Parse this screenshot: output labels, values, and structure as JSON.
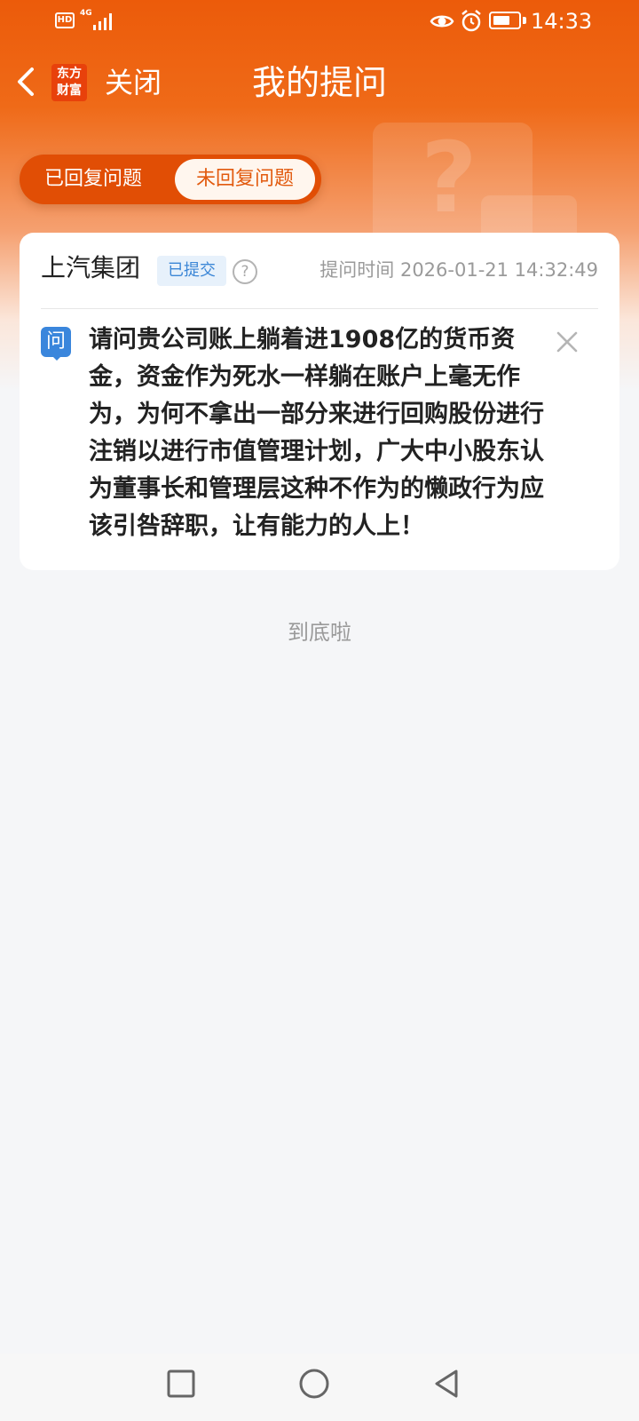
{
  "status_bar": {
    "hd": "HD",
    "network": "4G",
    "time": "14:33",
    "battery_level": 0.7
  },
  "nav": {
    "logo_text": "东方财富",
    "close_label": "关闭",
    "title": "我的提问"
  },
  "tabs": [
    {
      "label": "已回复问题",
      "active": false
    },
    {
      "label": "未回复问题",
      "active": true
    }
  ],
  "question_card": {
    "company": "上汽集团",
    "status": "已提交",
    "help_symbol": "?",
    "ask_time": "提问时间 2026-01-21 14:32:49",
    "tag": "问",
    "text": "请问贵公司账上躺着进1908亿的货币资金，资金作为死水一样躺在账户上毫无作为，为何不拿出一部分来进行回购股份进行注销以进行市值管理计划，广大中小股东认为董事长和管理层这种不作为的懒政行为应该引咎辞职，让有能力的人上！"
  },
  "end_of_list": "到底啦",
  "colors": {
    "brand_orange": "#ec5b0a",
    "tab_active_text": "#e25a0e",
    "badge_blue": "#3b86d6",
    "question_tag": "#3a86dc",
    "background": "#f5f6f8"
  },
  "icons": {
    "back": "chevron-left-icon",
    "help": "question-circle-icon",
    "delete": "close-icon",
    "eye": "eye-icon",
    "alarm": "alarm-icon",
    "home": "circle-icon",
    "recents": "square-icon",
    "back_sys": "triangle-back-icon"
  }
}
